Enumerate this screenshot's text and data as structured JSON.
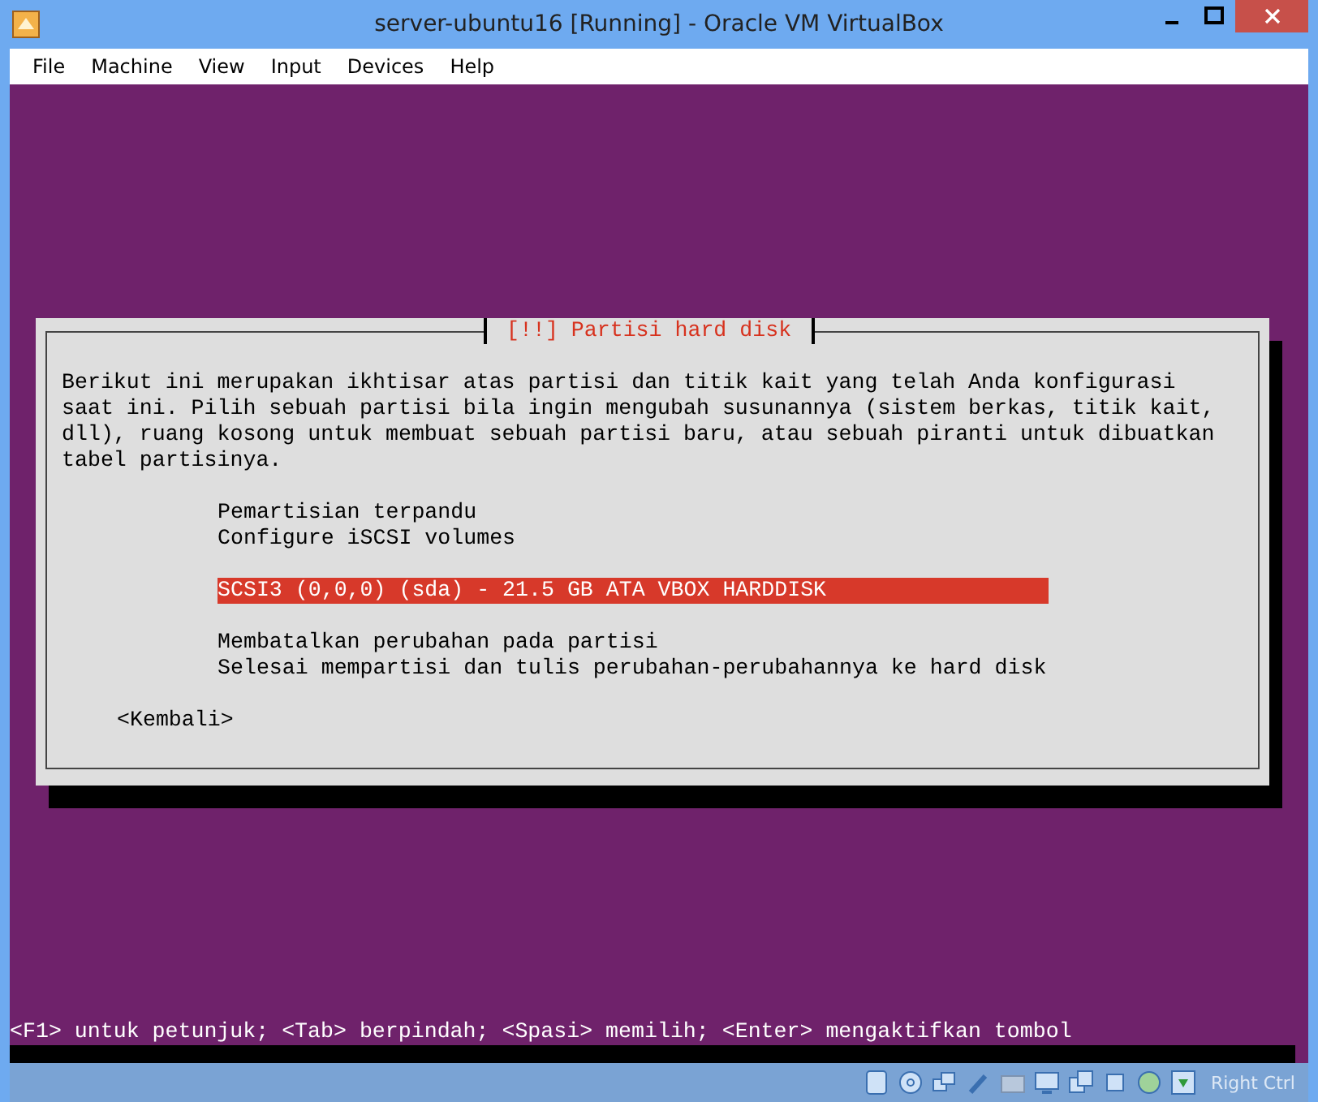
{
  "window": {
    "title": "server-ubuntu16 [Running] - Oracle VM VirtualBox"
  },
  "menu": [
    "File",
    "Machine",
    "View",
    "Input",
    "Devices",
    "Help"
  ],
  "dialog": {
    "title": "[!!] Partisi hard disk",
    "description": "Berikut ini merupakan ikhtisar atas partisi dan titik kait yang telah Anda konfigurasi saat ini. Pilih sebuah partisi bila ingin mengubah susunannya (sistem berkas, titik kait, dll), ruang kosong untuk membuat sebuah partisi baru, atau sebuah piranti untuk dibuatkan tabel partisinya.",
    "groups": [
      [
        {
          "label": "Pemartisian terpandu",
          "selected": false
        },
        {
          "label": "Configure iSCSI volumes",
          "selected": false
        }
      ],
      [
        {
          "label": "SCSI3 (0,0,0) (sda) - 21.5 GB ATA VBOX HARDDISK",
          "selected": true
        }
      ],
      [
        {
          "label": "Membatalkan perubahan pada partisi",
          "selected": false
        },
        {
          "label": "Selesai mempartisi dan tulis perubahan-perubahannya ke hard disk",
          "selected": false
        }
      ]
    ],
    "back_button": "<Kembali>"
  },
  "help_line": "<F1> untuk petunjuk; <Tab> berpindah; <Spasi> memilih; <Enter> mengaktifkan tombol",
  "status_bar": {
    "host_key": "Right Ctrl"
  }
}
